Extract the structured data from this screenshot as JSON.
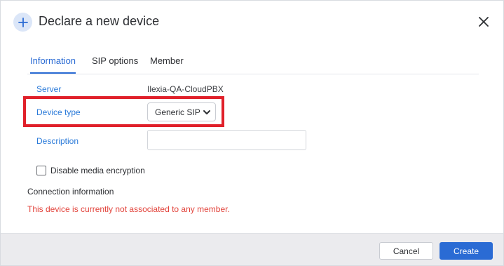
{
  "dialog": {
    "title": "Declare a new device",
    "header_icon": "plus-icon",
    "close_icon": "close-icon"
  },
  "tabs": [
    {
      "label": "Information",
      "active": true
    },
    {
      "label": "SIP options",
      "active": false
    },
    {
      "label": "Member",
      "active": false
    }
  ],
  "form": {
    "server_label": "Server",
    "server_value": "Ilexia-QA-CloudPBX",
    "device_type_label": "Device type",
    "device_type_value": "Generic SIP",
    "description_label": "Description",
    "description_value": "",
    "disable_encryption_label": "Disable media encryption",
    "disable_encryption_checked": false
  },
  "connection": {
    "title": "Connection information",
    "warning": "This device is currently not associated to any member."
  },
  "footer": {
    "cancel_label": "Cancel",
    "create_label": "Create"
  },
  "colors": {
    "accent": "#2a6bd4",
    "warning": "#e2433b",
    "highlight": "#e0202a"
  }
}
